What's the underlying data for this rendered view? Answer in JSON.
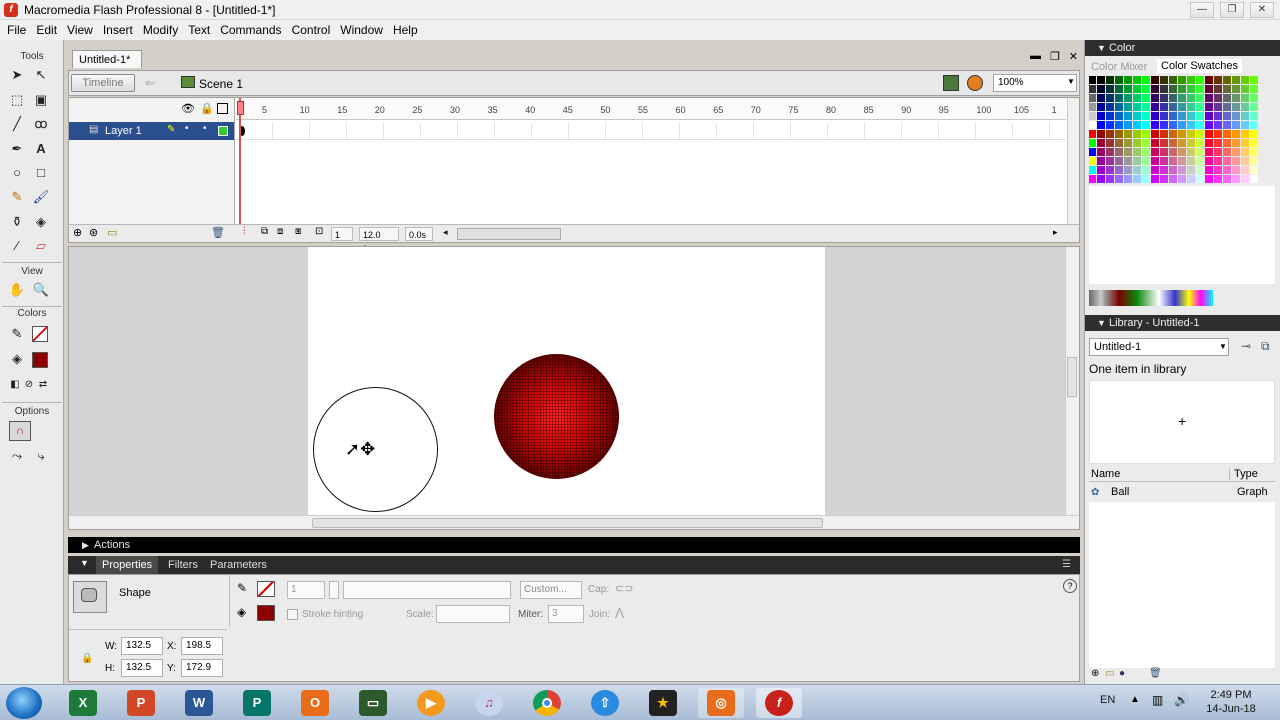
{
  "window": {
    "title": "Macromedia Flash Professional 8 - [Untitled-1*]",
    "minimize": "—",
    "maximize": "❐",
    "close": "✕"
  },
  "menu": [
    "File",
    "Edit",
    "View",
    "Insert",
    "Modify",
    "Text",
    "Commands",
    "Control",
    "Window",
    "Help"
  ],
  "tools": {
    "header": "Tools",
    "view_header": "View",
    "colors_header": "Colors",
    "options_header": "Options"
  },
  "document": {
    "tab": "Untitled-1*",
    "timeline_button": "Timeline",
    "scene": "Scene 1",
    "zoom": "100%"
  },
  "timeline": {
    "layer_name": "Layer 1",
    "ticks": [
      "1",
      "5",
      "10",
      "15",
      "20",
      "25",
      "30",
      "35",
      "40",
      "45",
      "50",
      "55",
      "60",
      "65",
      "70",
      "75",
      "80",
      "85",
      "90",
      "95",
      "100",
      "105",
      "1"
    ],
    "current_frame": "1",
    "fps": "12.0 fps",
    "time": "0.0s"
  },
  "actions": {
    "label": "Actions"
  },
  "properties": {
    "tabs": [
      "Properties",
      "Filters",
      "Parameters"
    ],
    "type": "Shape",
    "stroke_height": "1",
    "custom": "Custom...",
    "cap": "Cap:",
    "stroke_hinting": "Stroke hinting",
    "scale": "Scale:",
    "miter_label": "Miter:",
    "miter_value": "3",
    "join": "Join:",
    "w_label": "W:",
    "w": "132.5",
    "x_label": "X:",
    "x": "198.5",
    "h_label": "H:",
    "h": "132.5",
    "y_label": "Y:",
    "y": "172.9"
  },
  "color_panel": {
    "title": "Color",
    "tab_mixer": "Color Mixer",
    "tab_swatches": "Color Swatches"
  },
  "library": {
    "title": "Library - Untitled-1",
    "select": "Untitled-1",
    "count": "One item in library",
    "col_name": "Name",
    "col_type": "Type",
    "item_name": "Ball",
    "item_type": "Graph"
  },
  "taskbar": {
    "lang": "EN",
    "time": "2:49 PM",
    "date": "14-Jun-18"
  }
}
